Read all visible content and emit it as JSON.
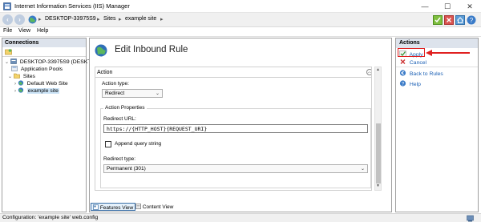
{
  "window": {
    "title": "Internet Information Services (IIS) Manager",
    "controls": {
      "minimize": "—",
      "maximize": "☐",
      "close": "✕"
    }
  },
  "address": {
    "crumbs": [
      "DESKTOP-33975S9",
      "Sites",
      "example site"
    ],
    "separator": "▸"
  },
  "menu": {
    "items": [
      "File",
      "View",
      "Help"
    ]
  },
  "connections": {
    "title": "Connections",
    "tree": [
      {
        "label": "DESKTOP-33975S9 (DESKTOP-",
        "arrow": "⌄",
        "icon": "server-icon"
      },
      {
        "label": "Application Pools",
        "arrow": "",
        "icon": "app-pools-icon"
      },
      {
        "label": "Sites",
        "arrow": "⌄",
        "icon": "folder-icon"
      },
      {
        "label": "Default Web Site",
        "arrow": "›",
        "icon": "globe-icon"
      },
      {
        "label": "example site",
        "arrow": "›",
        "icon": "globe-icon"
      }
    ]
  },
  "main": {
    "title": "Edit Inbound Rule",
    "action_section": "Action",
    "action_type_label": "Action type:",
    "action_type_value": "Redirect",
    "action_properties_label": "Action Properties",
    "redirect_url_label": "Redirect URL:",
    "redirect_url_value": "https://{HTTP_HOST}{REQUEST_URI}",
    "append_query_label": "Append query string",
    "append_query_checked": false,
    "redirect_type_label": "Redirect type:",
    "redirect_type_value": "Permanent (301)",
    "tabs": {
      "features_view": "Features View",
      "content_view": "Content View"
    }
  },
  "actions": {
    "title": "Actions",
    "items": [
      {
        "label": "Apply",
        "icon": "apply-icon"
      },
      {
        "label": "Cancel",
        "icon": "cancel-icon"
      },
      {
        "label": "Back to Rules",
        "icon": "back-icon"
      },
      {
        "label": "Help",
        "icon": "help-icon"
      }
    ]
  },
  "status": {
    "text": "Configuration: 'example site' web.config"
  },
  "colors": {
    "highlight": "#e02020",
    "link": "#1a5fb4",
    "panel_header": "#dde3ec"
  }
}
